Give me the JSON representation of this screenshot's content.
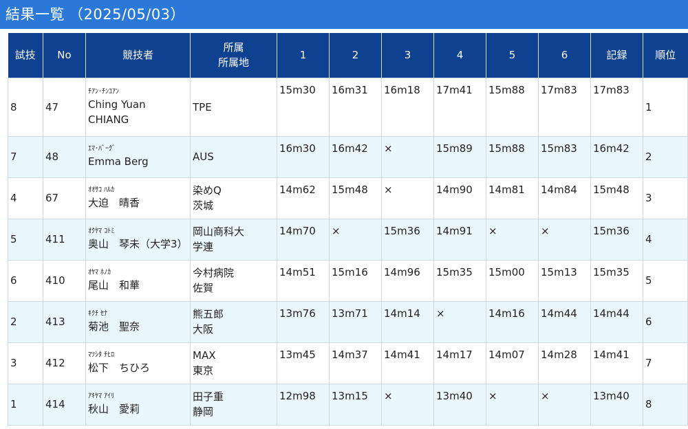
{
  "page": {
    "title": "結果一覧",
    "date": "（2025/05/03）"
  },
  "table": {
    "headers": {
      "order": "試技",
      "no": "No",
      "athlete": "競技者",
      "affiliation_line1": "所属",
      "affiliation_line2": "所属地",
      "t1": "1",
      "t2": "2",
      "t3": "3",
      "t4": "4",
      "t5": "5",
      "t6": "6",
      "record": "記録",
      "rank": "順位"
    },
    "rows": [
      {
        "order": "8",
        "no": "47",
        "kana": "ﾁｱﾝ･ﾁﾝﾕｱﾝ",
        "name1": "Ching Yuan",
        "name2": "CHIANG",
        "aff1": "TPE",
        "aff2": "",
        "t1": "15m30",
        "t2": "16m31",
        "t3": "16m18",
        "t4": "17m41",
        "t5": "15m88",
        "t6": "17m83",
        "record": "17m83",
        "rank": "1"
      },
      {
        "order": "7",
        "no": "48",
        "kana": "ｴﾏ･ﾊﾞｰｸﾞ",
        "name1": "Emma Berg",
        "name2": "",
        "aff1": "AUS",
        "aff2": "",
        "t1": "16m30",
        "t2": "16m42",
        "t3": "×",
        "t4": "15m89",
        "t5": "15m88",
        "t6": "15m83",
        "record": "16m42",
        "rank": "2"
      },
      {
        "order": "4",
        "no": "67",
        "kana": "ｵｵｻｺ ﾊﾙｶ",
        "name1": "大迫　晴香",
        "name2": "",
        "aff1": "染めQ",
        "aff2": "茨城",
        "t1": "14m62",
        "t2": "15m48",
        "t3": "×",
        "t4": "14m90",
        "t5": "14m81",
        "t6": "14m84",
        "record": "15m48",
        "rank": "3"
      },
      {
        "order": "5",
        "no": "411",
        "kana": "ｵｸﾔﾏ ｺﾄﾐ",
        "name1": "奥山　琴未（大学3）",
        "name2": "",
        "aff1": "岡山商科大",
        "aff2": "学連",
        "t1": "14m70",
        "t2": "×",
        "t3": "15m36",
        "t4": "14m91",
        "t5": "×",
        "t6": "×",
        "record": "15m36",
        "rank": "4"
      },
      {
        "order": "6",
        "no": "410",
        "kana": "ｵﾔﾏ ﾎﾉｶ",
        "name1": "尾山　和華",
        "name2": "",
        "aff1": "今村病院",
        "aff2": "佐賀",
        "t1": "14m51",
        "t2": "15m16",
        "t3": "14m96",
        "t4": "15m35",
        "t5": "15m00",
        "t6": "15m13",
        "record": "15m35",
        "rank": "5"
      },
      {
        "order": "2",
        "no": "413",
        "kana": "ｷｸﾁ ｾﾅ",
        "name1": "菊池　聖奈",
        "name2": "",
        "aff1": "熊五郎",
        "aff2": "大阪",
        "t1": "13m76",
        "t2": "13m71",
        "t3": "14m14",
        "t4": "×",
        "t5": "14m16",
        "t6": "14m44",
        "record": "14m44",
        "rank": "6"
      },
      {
        "order": "3",
        "no": "412",
        "kana": "ﾏﾂｼﾀ ﾁﾋﾛ",
        "name1": "松下　ちひろ",
        "name2": "",
        "aff1": "MAX",
        "aff2": "東京",
        "t1": "13m45",
        "t2": "14m37",
        "t3": "14m41",
        "t4": "14m17",
        "t5": "14m07",
        "t6": "14m28",
        "record": "14m41",
        "rank": "7"
      },
      {
        "order": "1",
        "no": "414",
        "kana": "ｱｷﾔﾏ ｱｲﾘ",
        "name1": "秋山　愛莉",
        "name2": "",
        "aff1": "田子重",
        "aff2": "静岡",
        "t1": "12m98",
        "t2": "13m15",
        "t3": "×",
        "t4": "13m40",
        "t5": "×",
        "t6": "×",
        "record": "13m40",
        "rank": "8"
      }
    ]
  }
}
